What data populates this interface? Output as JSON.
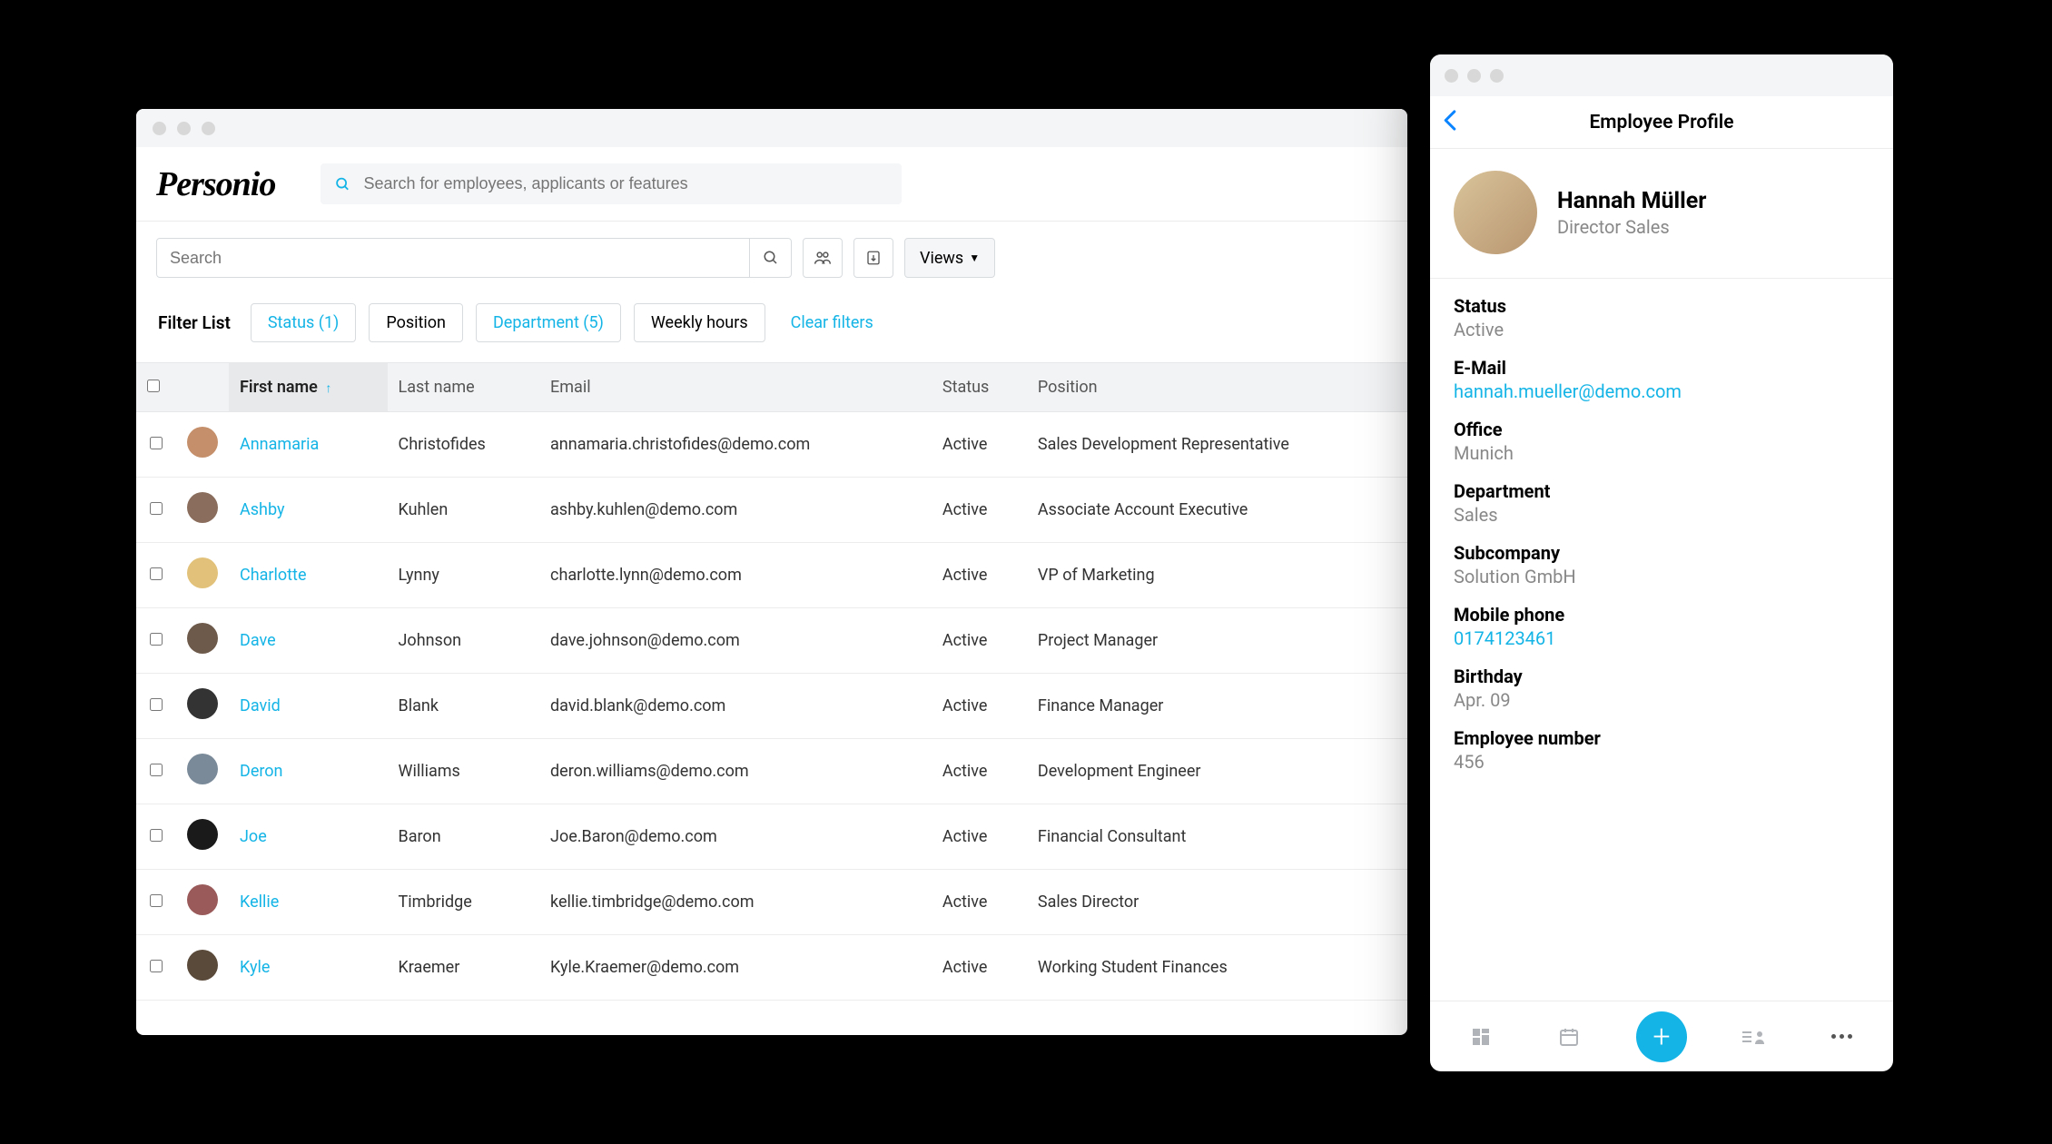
{
  "brand": "Personio",
  "globalSearch": {
    "placeholder": "Search for employees, applicants or features"
  },
  "localSearch": {
    "placeholder": "Search"
  },
  "viewsLabel": "Views",
  "filters": {
    "label": "Filter List",
    "chips": [
      {
        "label": "Status (1)",
        "active": true
      },
      {
        "label": "Position",
        "active": false
      },
      {
        "label": "Department (5)",
        "active": true
      },
      {
        "label": "Weekly hours",
        "active": false
      }
    ],
    "clear": "Clear filters"
  },
  "table": {
    "headers": {
      "firstName": "First name",
      "lastName": "Last name",
      "email": "Email",
      "status": "Status",
      "position": "Position"
    },
    "rows": [
      {
        "first": "Annamaria",
        "last": "Christofides",
        "email": "annamaria.christofides@demo.com",
        "status": "Active",
        "position": "Sales Development Representative",
        "av": "av1"
      },
      {
        "first": "Ashby",
        "last": "Kuhlen",
        "email": "ashby.kuhlen@demo.com",
        "status": "Active",
        "position": "Associate Account Executive",
        "av": "av2"
      },
      {
        "first": "Charlotte",
        "last": "Lynny",
        "email": "charlotte.lynn@demo.com",
        "status": "Active",
        "position": "VP of Marketing",
        "av": "av3"
      },
      {
        "first": "Dave",
        "last": "Johnson",
        "email": "dave.johnson@demo.com",
        "status": "Active",
        "position": "Project Manager",
        "av": "av4"
      },
      {
        "first": "David",
        "last": "Blank",
        "email": "david.blank@demo.com",
        "status": "Active",
        "position": "Finance Manager",
        "av": "av5"
      },
      {
        "first": "Deron",
        "last": "Williams",
        "email": "deron.williams@demo.com",
        "status": "Active",
        "position": "Development Engineer",
        "av": "av6"
      },
      {
        "first": "Joe",
        "last": "Baron",
        "email": "Joe.Baron@demo.com",
        "status": "Active",
        "position": "Financial Consultant",
        "av": "av7"
      },
      {
        "first": "Kellie",
        "last": "Timbridge",
        "email": "kellie.timbridge@demo.com",
        "status": "Active",
        "position": "Sales Director",
        "av": "av8"
      },
      {
        "first": "Kyle",
        "last": "Kraemer",
        "email": "Kyle.Kraemer@demo.com",
        "status": "Active",
        "position": "Working Student Finances",
        "av": "av9"
      }
    ]
  },
  "mobile": {
    "title": "Employee Profile",
    "name": "Hannah Müller",
    "role": "Director Sales",
    "fields": [
      {
        "label": "Status",
        "value": "Active",
        "link": false
      },
      {
        "label": "E-Mail",
        "value": "hannah.mueller@demo.com",
        "link": true
      },
      {
        "label": "Office",
        "value": "Munich",
        "link": false
      },
      {
        "label": "Department",
        "value": "Sales",
        "link": false
      },
      {
        "label": "Subcompany",
        "value": "Solution GmbH",
        "link": false
      },
      {
        "label": "Mobile phone",
        "value": "0174123461",
        "link": true
      },
      {
        "label": "Birthday",
        "value": "Apr. 09",
        "link": false
      },
      {
        "label": "Employee number",
        "value": "456",
        "link": false
      }
    ]
  }
}
